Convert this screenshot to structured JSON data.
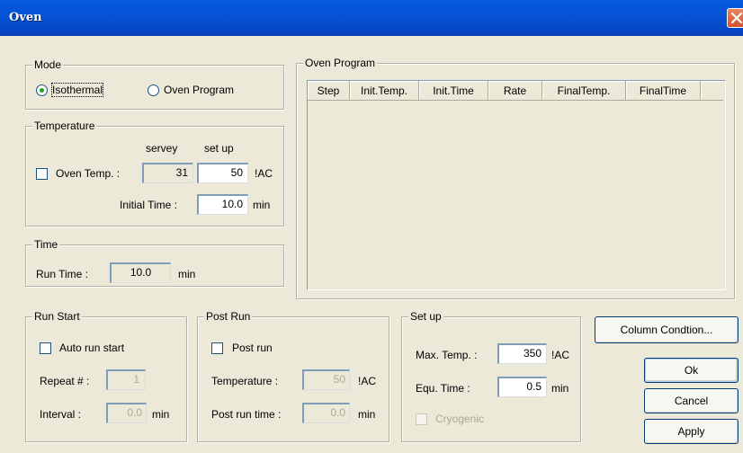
{
  "window": {
    "title": "Oven"
  },
  "mode": {
    "legend": "Mode",
    "isothermal": "Isothermal",
    "oven_program": "Oven Program",
    "selected": "Isothermal"
  },
  "temperature": {
    "legend": "Temperature",
    "col_servey": "servey",
    "col_setup": "set up",
    "oven_temp_label": "Oven Temp. :",
    "oven_temp_servey": "31",
    "oven_temp_setup": "50",
    "oven_temp_unit": "!AC",
    "initial_time_label": "Initial Time :",
    "initial_time_value": "10.0",
    "initial_time_unit": "min"
  },
  "time": {
    "legend": "Time",
    "run_time_label": "Run Time :",
    "run_time_value": "10.0",
    "run_time_unit": "min"
  },
  "oven_program": {
    "legend": "Oven Program",
    "columns": [
      "Step",
      "Init.Temp.",
      "Init.Time",
      "Rate",
      "FinalTemp.",
      "FinalTime"
    ],
    "rows": []
  },
  "run_start": {
    "legend": "Run Start",
    "auto_run_label": "Auto run start",
    "repeat_label": "Repeat # :",
    "repeat_value": "1",
    "interval_label": "Interval :",
    "interval_value": "0.0",
    "interval_unit": "min"
  },
  "post_run": {
    "legend": "Post Run",
    "post_run_label": "Post run",
    "temperature_label": "Temperature :",
    "temperature_value": "50",
    "temperature_unit": "!AC",
    "time_label": "Post run time :",
    "time_value": "0.0",
    "time_unit": "min"
  },
  "setup": {
    "legend": "Set up",
    "max_temp_label": "Max. Temp. :",
    "max_temp_value": "350",
    "max_temp_unit": "!AC",
    "equ_time_label": "Equ. Time :",
    "equ_time_value": "0.5",
    "equ_time_unit": "min",
    "cryogenic_label": "Cryogenic"
  },
  "buttons": {
    "column_condition": "Column Condtion...",
    "ok": "Ok",
    "cancel": "Cancel",
    "apply": "Apply"
  },
  "colors": {
    "titlebar": "#0458dc",
    "dialog_bg": "#ece9d8",
    "close_button": "#d5512c"
  }
}
